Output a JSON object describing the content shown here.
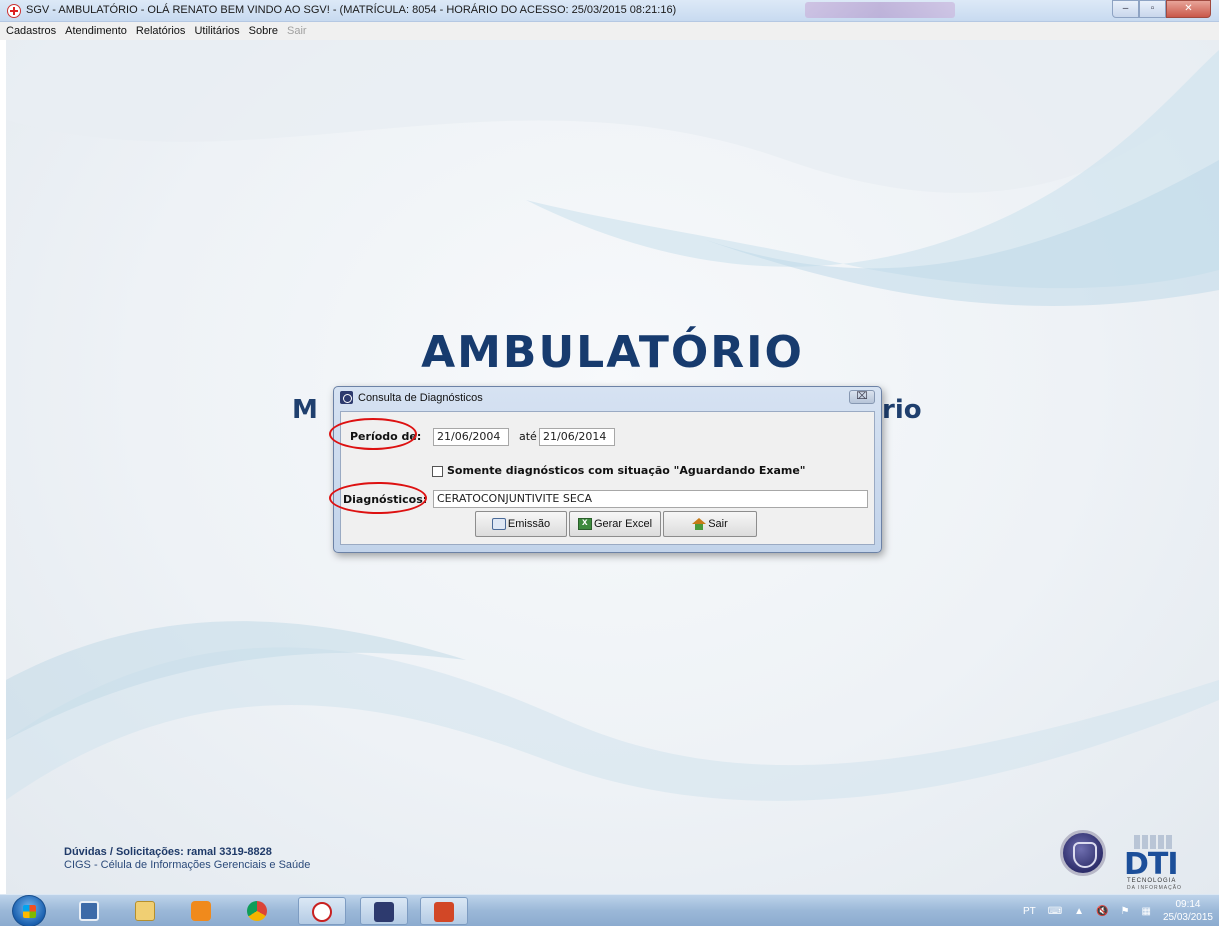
{
  "window": {
    "title": "SGV - AMBULATÓRIO - OLÁ RENATO BEM VINDO AO SGV! - (MATRÍCULA: 8054 - HORÁRIO DO ACESSO: 25/03/2015 08:21:16)",
    "minimize_icon": "minimize-icon",
    "maximize_icon": "maximize-icon",
    "close_icon": "close-icon"
  },
  "menu": {
    "items": [
      "Cadastros",
      "Atendimento",
      "Relatórios",
      "Utilitários",
      "Sobre",
      "Sair"
    ]
  },
  "background": {
    "headline": "AMBULATÓRIO",
    "subhead_left": "M",
    "subhead_right": "rio",
    "footer_line1": "Dúvidas / Solicitações: ramal 3319-8828",
    "footer_line2": "CIGS - Célula de Informações Gerenciais e Saúde",
    "logo_text": "DTI",
    "logo_sub1": "TECNOLOGIA",
    "logo_sub2": "DA INFORMAÇÃO"
  },
  "dialog": {
    "title": "Consulta de Diagnósticos",
    "close_glyph": "⌧",
    "periodo_label": "Período de:",
    "periodo_from": "21/06/2004",
    "ate_label": "até",
    "periodo_to": "21/06/2014",
    "checkbox_label": "Somente diagnósticos com situação \"Aguardando Exame\"",
    "checkbox_checked": false,
    "diagnosticos_label": "Diagnósticos:",
    "diagnosticos_value": "CERATOCONJUNTIVITE SECA",
    "buttons": {
      "emissao": "Emissão",
      "gerar_excel": "Gerar Excel",
      "sair": "Sair"
    }
  },
  "taskbar": {
    "language": "PT",
    "time": "09:14",
    "date": "25/03/2015"
  },
  "colors": {
    "headline": "#173b6e",
    "annotation": "#dd1111",
    "dialog_frame": "#c2d3ea"
  }
}
